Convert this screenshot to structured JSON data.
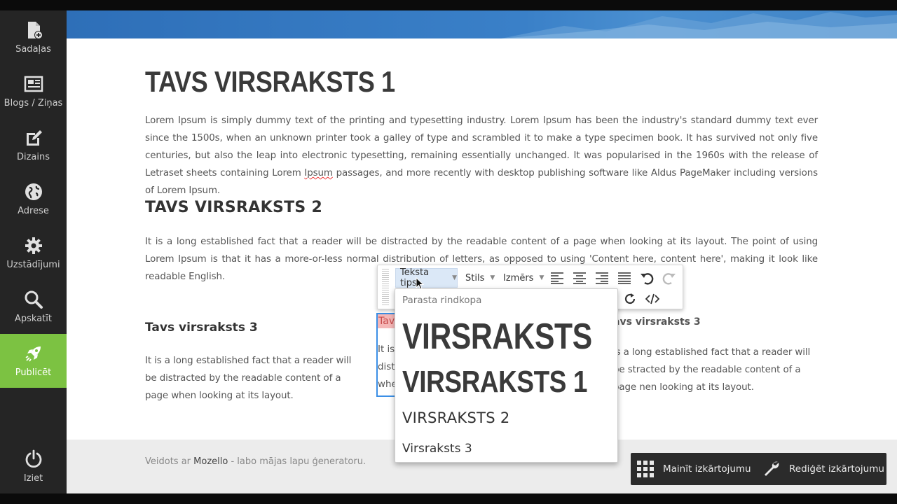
{
  "sidebar": {
    "items": [
      {
        "label": "Sadaļas",
        "icon": "page-add-icon"
      },
      {
        "label": "Blogs / Ziņas",
        "icon": "newspaper-icon"
      },
      {
        "label": "Dizains",
        "icon": "edit-icon"
      },
      {
        "label": "Adrese",
        "icon": "globe-icon"
      },
      {
        "label": "Uzstādījumi",
        "icon": "gear-icon"
      },
      {
        "label": "Apskatīt",
        "icon": "search-icon"
      },
      {
        "label": "Publicēt",
        "icon": "rocket-icon"
      }
    ],
    "logout": {
      "label": "Iziet",
      "icon": "power-icon"
    },
    "active_index": 6,
    "active_color": "#7cc242"
  },
  "page": {
    "h1": "TAVS VIRSRAKSTS 1",
    "p1_before": "Lorem Ipsum is simply dummy text of the printing and typesetting industry. Lorem Ipsum has been the industry's standard dummy text ever since the 1500s, when an unknown printer took a galley of type and scrambled it to make a type specimen book. It has survived not only five centuries, but also the leap into electronic typesetting, remaining essentially unchanged. It was popularised in the 1960s with the release of Letraset sheets containing Lorem ",
    "p1_spell": "Ipsum",
    "p1_after": " passages, and more recently with desktop publishing software like Aldus PageMaker including versions of Lorem Ipsum.",
    "h2": "TAVS VIRSRAKSTS 2",
    "p2": "It is a long established fact that a reader will be distracted by the readable content of a page when looking at its layout. The point of using Lorem Ipsum is that it has a more-or-less normal distribution of letters, as opposed to using 'Content here, content here', making it look like readable English.",
    "col1": {
      "h3": "Tavs virsraksts 3",
      "text": "It is a long established fact that a reader will be distracted by the readable content of a page when looking at its layout."
    },
    "col2": {
      "h3_visible": "Tavs",
      "lines": [
        "It is",
        "dist",
        "whe"
      ]
    },
    "col3": {
      "h3": "avs virsraksts 3",
      "text": "is a long established fact that a reader will be stracted by the readable content of a page nen looking at its layout."
    },
    "footer_prefix": "Veidots ar ",
    "footer_brand": "Mozello",
    "footer_suffix": " - labo mājas lapu ģeneratoru."
  },
  "toolbar": {
    "text_type": "Teksta tips",
    "style": "Stils",
    "size": "Izmērs",
    "buttons": [
      "align-left-icon",
      "align-center-icon",
      "align-right-icon",
      "align-justify-icon",
      "undo-icon",
      "redo-icon",
      "refresh-icon",
      "code-icon"
    ]
  },
  "dropdown": {
    "paragraph": "Parasta rindkopa",
    "heading": "VIRSRAKSTS",
    "heading1": "VIRSRAKSTS 1",
    "heading2": "VIRSRAKSTS 2",
    "heading3": "Virsraksts 3"
  },
  "layout_bar": {
    "change_layout": "Mainīt izkārtojumu",
    "edit_layout": "Rediģēt izkārtojumu"
  }
}
